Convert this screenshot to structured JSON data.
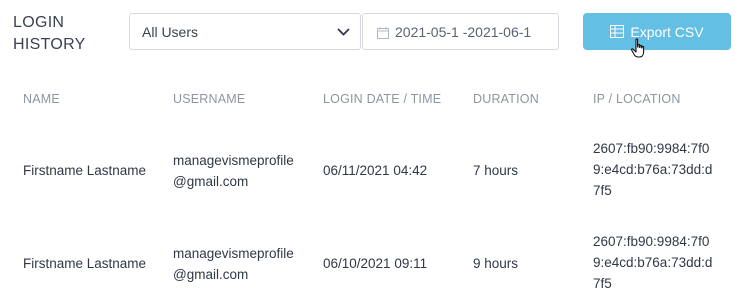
{
  "header": {
    "title_line1": "LOGIN",
    "title_line2": "HISTORY"
  },
  "filters": {
    "user_select_value": "All Users",
    "date_range_value": "2021-05-1 -2021-06-1"
  },
  "actions": {
    "export_label": "Export CSV"
  },
  "table": {
    "columns": [
      "NAME",
      "USERNAME",
      "LOGIN DATE / TIME",
      "DURATION",
      "IP / LOCATION"
    ],
    "rows": [
      {
        "name": "Firstname Lastname",
        "username": "managevismeprofile@gmail.com",
        "login": "06/11/2021 04:42",
        "duration": "7 hours",
        "ip": "2607:fb90:9984:7f09:e4cd:b76a:73dd:d7f5"
      },
      {
        "name": "Firstname Lastname",
        "username": "managevismeprofile@gmail.com",
        "login": "06/10/2021 09:11",
        "duration": "9 hours",
        "ip": "2607:fb90:9984:7f09:e4cd:b76a:73dd:d7f5"
      }
    ]
  },
  "colors": {
    "accent": "#63bfe3",
    "header_text": "#8e95a0",
    "border": "#d6dae0"
  },
  "icons": [
    "chevron-down-icon",
    "calendar-icon",
    "table-icon",
    "hand-cursor-icon"
  ]
}
